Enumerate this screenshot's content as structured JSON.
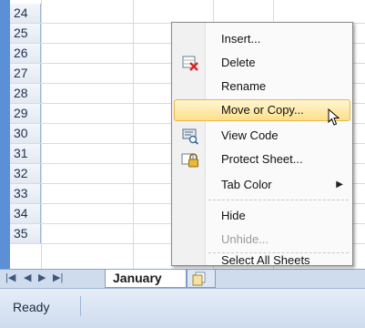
{
  "rows": [
    "24",
    "25",
    "26",
    "27",
    "28",
    "29",
    "30",
    "31",
    "32",
    "33",
    "34",
    "35"
  ],
  "sheet_tab": "January",
  "status": "Ready",
  "menu": {
    "items": [
      {
        "label": "Insert..."
      },
      {
        "label": "Delete"
      },
      {
        "label": "Rename"
      },
      {
        "label": "Move or Copy..."
      },
      {
        "label": "View Code"
      },
      {
        "label": "Protect Sheet..."
      },
      {
        "label": "Tab Color"
      },
      {
        "label": "Hide"
      },
      {
        "label": "Unhide..."
      },
      {
        "label": "Select All Sheets"
      }
    ]
  }
}
